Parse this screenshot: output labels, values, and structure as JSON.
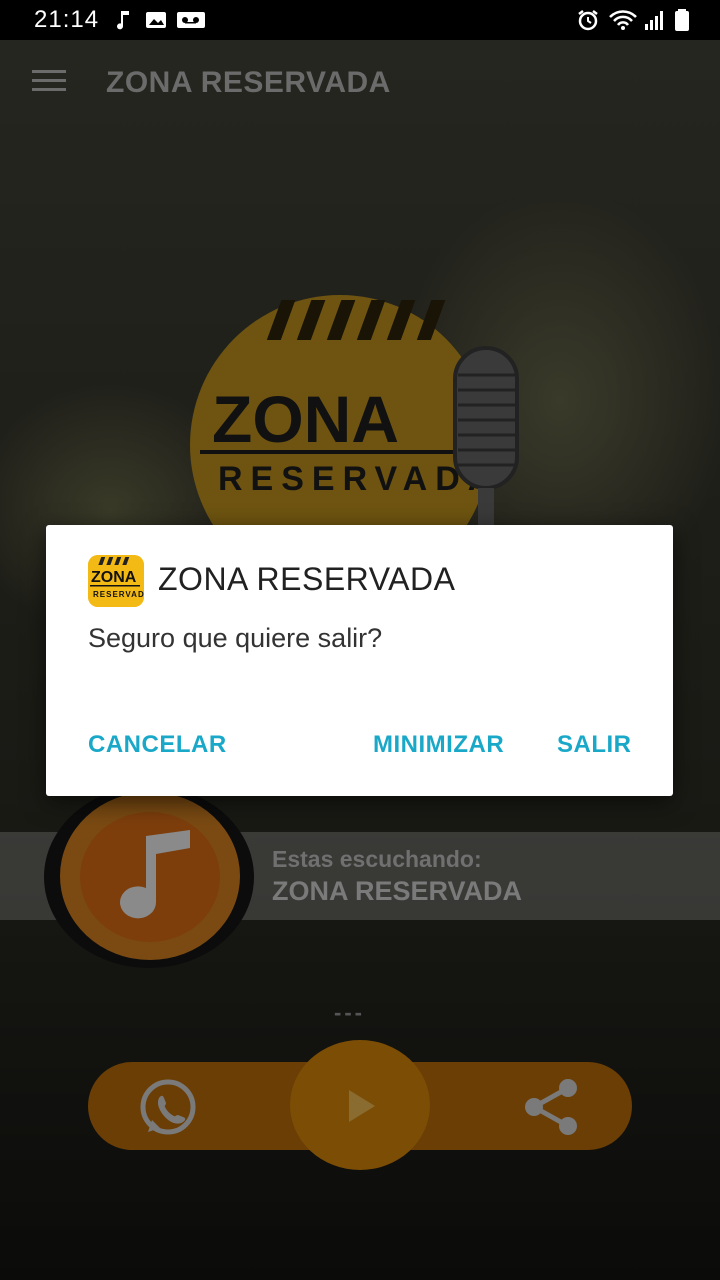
{
  "status_bar": {
    "time": "21:14",
    "left_icons": [
      "music-note-icon",
      "image-icon",
      "voicemail-icon"
    ],
    "right_icons": [
      "alarm-icon",
      "wifi-icon",
      "signal-icon",
      "battery-icon"
    ]
  },
  "app_bar": {
    "title": "ZONA RESERVADA"
  },
  "logo": {
    "line1": "ZONA",
    "line2": "RESERVADA"
  },
  "now_playing": {
    "label": "Estas escuchando:",
    "station": "ZONA RESERVADA",
    "track_placeholder": "---"
  },
  "controls": {
    "whatsapp_icon": "whatsapp-icon",
    "play_icon": "play-icon",
    "share_icon": "share-icon"
  },
  "dialog": {
    "title": "ZONA RESERVADA",
    "message": "Seguro que quiere salir?",
    "buttons": {
      "cancel": "CANCELAR",
      "minimize": "MINIMIZAR",
      "exit": "SALIR"
    }
  },
  "colors": {
    "accent": "#1aa8c9",
    "brand_yellow": "#f3b914",
    "control_orange": "#6b3e05"
  }
}
